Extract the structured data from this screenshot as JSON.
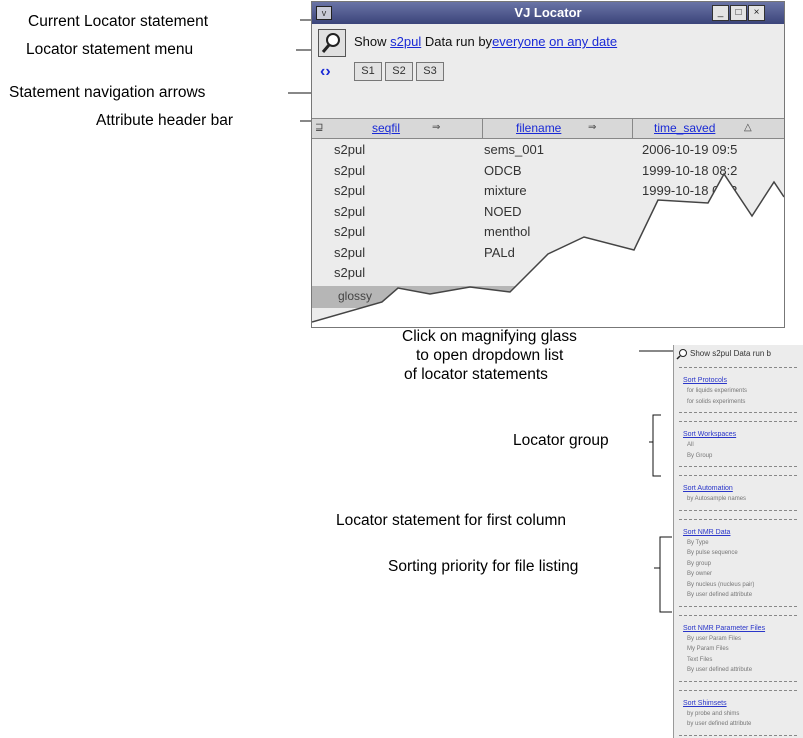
{
  "callouts": {
    "current_statement": "Current Locator statement",
    "statement_menu": "Locator statement menu",
    "nav_arrows": "Statement navigation arrows",
    "header_bar": "Attribute header bar",
    "magnifier_line1": "Click on magnifying glass",
    "magnifier_line2": "to open dropdown list",
    "magnifier_line3": "of locator statements",
    "locator_group": "Locator group",
    "first_column": "Locator statement for first column",
    "sorting": "Sorting priority for file listing"
  },
  "window": {
    "title": "VJ Locator",
    "menu_glyph": "v",
    "min_glyph": "_",
    "max_glyph": "□",
    "close_glyph": "×"
  },
  "statement": {
    "show": "Show",
    "subject": "s2pul",
    "middle": "Data run by",
    "user": "everyone",
    "date": "on any date"
  },
  "nav": {
    "arrows": "‹›",
    "buttons": [
      "S1",
      "S2",
      "S3"
    ]
  },
  "table": {
    "corner_icon": "⊒",
    "columns": [
      "seqfil",
      "filename",
      "time_saved"
    ],
    "sort_glyph": "⇒",
    "sort_indicator": "△",
    "rows": [
      [
        "s2pul",
        "sems_001",
        "2006-10-19 09:5"
      ],
      [
        "s2pul",
        "ODCB",
        "1999-10-18 08:2"
      ],
      [
        "s2pul",
        "mixture",
        "1999-10-18 08:2"
      ],
      [
        "s2pul",
        "NOED",
        ""
      ],
      [
        "s2pul",
        "menthol",
        ""
      ],
      [
        "s2pul",
        "PALd",
        ""
      ],
      [
        "s2pul",
        "",
        ""
      ]
    ],
    "last_row": "glossy"
  },
  "dropdown": {
    "head": "Show s2pul Data run b",
    "groups": [
      {
        "title": "Sort Protocols",
        "items": [
          "for liquids experiments",
          "for solids experiments"
        ]
      },
      {
        "title": "Sort Workspaces",
        "items": [
          "All",
          "By Group"
        ]
      },
      {
        "title": "Sort Automation",
        "items": [
          "by Autosample names"
        ]
      },
      {
        "title": "Sort NMR Data",
        "items": [
          "By Type",
          "By pulse sequence",
          "By group",
          "By owner",
          "By nucleus (nucleus pair)",
          "By user defined attribute"
        ]
      },
      {
        "title": "Sort NMR Parameter Files",
        "items": [
          "By user Param Files",
          "My Param Files",
          "Text Files",
          "By user defined attribute"
        ]
      },
      {
        "title": "Sort Shimsets",
        "items": [
          "by probe and shims",
          "by user defined attribute"
        ]
      }
    ]
  }
}
